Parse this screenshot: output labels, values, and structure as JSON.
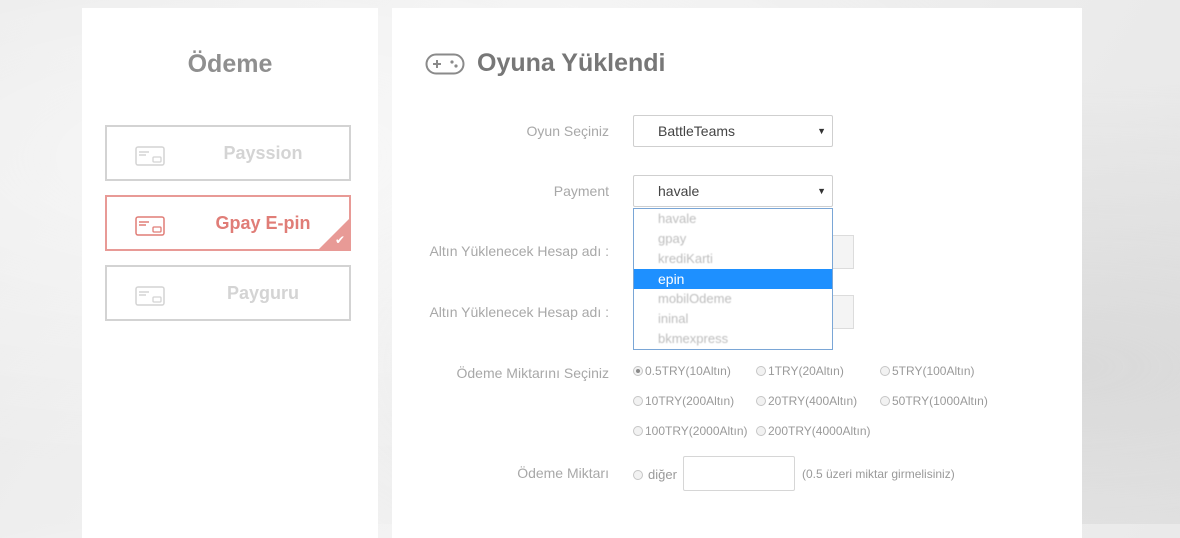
{
  "sidebar": {
    "title": "Ödeme",
    "methods": [
      {
        "label": "Payssion",
        "active": false,
        "icon": "card-icon"
      },
      {
        "label": "Gpay E-pin",
        "active": true,
        "icon": "card-icon"
      },
      {
        "label": "Payguru",
        "active": false,
        "icon": "card-icon"
      }
    ],
    "check_mark": "✔"
  },
  "main": {
    "title": "Oyuna Yüklendi",
    "header_icon": "gamepad-icon",
    "fields": {
      "game_label": "Oyun Seçiniz",
      "game_value": "BattleTeams",
      "payment_label": "Payment",
      "payment_value": "havale",
      "account_label_1": "Altın Yüklenecek Hesap adı :",
      "account_label_2": "Altın Yüklenecek Hesap adı :",
      "amount_select_label": "Ödeme Miktarını Seçiniz",
      "amount_label": "Ödeme Miktarı",
      "other_option": "diğer",
      "amount_hint": "(0.5 üzeri miktar girmelisiniz)"
    },
    "dropdown": {
      "options": [
        "havale",
        "gpay",
        "krediKarti",
        "epin",
        "mobilOdeme",
        "ininal",
        "bkmexpress"
      ],
      "highlighted": "epin"
    },
    "amount_options": [
      {
        "label": "0.5TRY(10Altın)",
        "checked": true
      },
      {
        "label": "1TRY(20Altın)",
        "checked": false
      },
      {
        "label": "5TRY(100Altın)",
        "checked": false
      },
      {
        "label": "10TRY(200Altın)",
        "checked": false
      },
      {
        "label": "20TRY(400Altın)",
        "checked": false
      },
      {
        "label": "50TRY(1000Altın)",
        "checked": false
      },
      {
        "label": "100TRY(2000Altın)",
        "checked": false
      },
      {
        "label": "200TRY(4000Altın)",
        "checked": false
      }
    ],
    "arrow_glyph": "▼"
  },
  "colors": {
    "accent": "#e07d77",
    "highlight": "#1e90ff"
  }
}
